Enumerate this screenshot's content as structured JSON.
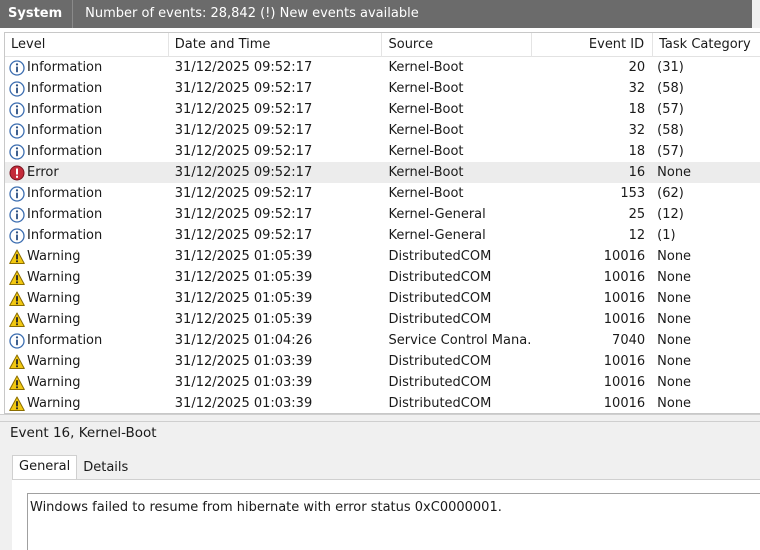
{
  "titlebar": {
    "log_name": "System",
    "event_count": "Number of events: 28,842 (!) New events available"
  },
  "columns": [
    "Level",
    "Date and Time",
    "Source",
    "Event ID",
    "Task Category"
  ],
  "events": [
    {
      "level": "Information",
      "icon": "information-icon",
      "date": "31/12/2025 09:52:17",
      "source": "Kernel-Boot",
      "id": "20",
      "task": "(31)"
    },
    {
      "level": "Information",
      "icon": "information-icon",
      "date": "31/12/2025 09:52:17",
      "source": "Kernel-Boot",
      "id": "32",
      "task": "(58)"
    },
    {
      "level": "Information",
      "icon": "information-icon",
      "date": "31/12/2025 09:52:17",
      "source": "Kernel-Boot",
      "id": "18",
      "task": "(57)"
    },
    {
      "level": "Information",
      "icon": "information-icon",
      "date": "31/12/2025 09:52:17",
      "source": "Kernel-Boot",
      "id": "32",
      "task": "(58)"
    },
    {
      "level": "Information",
      "icon": "information-icon",
      "date": "31/12/2025 09:52:17",
      "source": "Kernel-Boot",
      "id": "18",
      "task": "(57)"
    },
    {
      "level": "Error",
      "icon": "error-icon",
      "date": "31/12/2025 09:52:17",
      "source": "Kernel-Boot",
      "id": "16",
      "task": "None",
      "selected": true
    },
    {
      "level": "Information",
      "icon": "information-icon",
      "date": "31/12/2025 09:52:17",
      "source": "Kernel-Boot",
      "id": "153",
      "task": "(62)"
    },
    {
      "level": "Information",
      "icon": "information-icon",
      "date": "31/12/2025 09:52:17",
      "source": "Kernel-General",
      "id": "25",
      "task": "(12)"
    },
    {
      "level": "Information",
      "icon": "information-icon",
      "date": "31/12/2025 09:52:17",
      "source": "Kernel-General",
      "id": "12",
      "task": "(1)"
    },
    {
      "level": "Warning",
      "icon": "warning-icon",
      "date": "31/12/2025 01:05:39",
      "source": "DistributedCOM",
      "id": "10016",
      "task": "None"
    },
    {
      "level": "Warning",
      "icon": "warning-icon",
      "date": "31/12/2025 01:05:39",
      "source": "DistributedCOM",
      "id": "10016",
      "task": "None"
    },
    {
      "level": "Warning",
      "icon": "warning-icon",
      "date": "31/12/2025 01:05:39",
      "source": "DistributedCOM",
      "id": "10016",
      "task": "None"
    },
    {
      "level": "Warning",
      "icon": "warning-icon",
      "date": "31/12/2025 01:05:39",
      "source": "DistributedCOM",
      "id": "10016",
      "task": "None"
    },
    {
      "level": "Information",
      "icon": "information-icon",
      "date": "31/12/2025 01:04:26",
      "source": "Service Control Mana...",
      "id": "7040",
      "task": "None"
    },
    {
      "level": "Warning",
      "icon": "warning-icon",
      "date": "31/12/2025 01:03:39",
      "source": "DistributedCOM",
      "id": "10016",
      "task": "None"
    },
    {
      "level": "Warning",
      "icon": "warning-icon",
      "date": "31/12/2025 01:03:39",
      "source": "DistributedCOM",
      "id": "10016",
      "task": "None"
    },
    {
      "level": "Warning",
      "icon": "warning-icon",
      "date": "31/12/2025 01:03:39",
      "source": "DistributedCOM",
      "id": "10016",
      "task": "None"
    }
  ],
  "details": {
    "title": "Event 16, Kernel-Boot",
    "tabs": [
      "General",
      "Details"
    ],
    "active_tab": "General",
    "message": "Windows failed to resume from hibernate with error status 0xC0000001."
  },
  "colors": {
    "titlebar": "#6b6b6b",
    "selected_row": "#ececec",
    "info_icon": "#3b6db0",
    "error_icon": "#c42b3a",
    "warning_icon": "#f2c811"
  }
}
